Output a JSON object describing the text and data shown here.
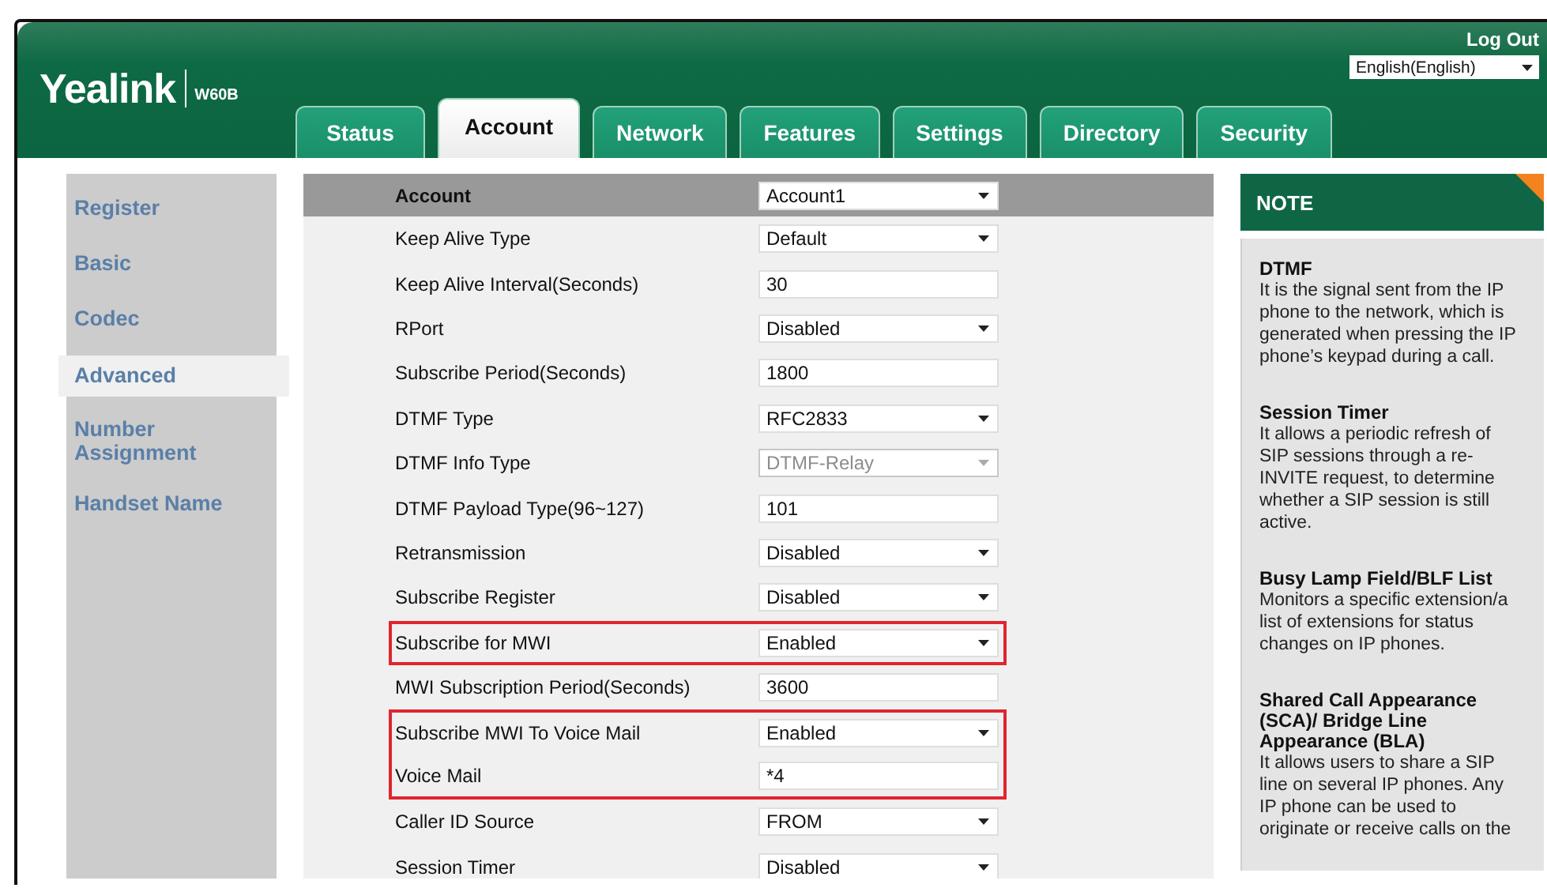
{
  "header": {
    "logo": "Yealink",
    "model": "W60B",
    "logout": "Log Out",
    "language": "English(English)"
  },
  "tabs": [
    {
      "label": "Status",
      "selected": false
    },
    {
      "label": "Account",
      "selected": true
    },
    {
      "label": "Network",
      "selected": false
    },
    {
      "label": "Features",
      "selected": false
    },
    {
      "label": "Settings",
      "selected": false
    },
    {
      "label": "Directory",
      "selected": false
    },
    {
      "label": "Security",
      "selected": false
    }
  ],
  "sidebar": {
    "items": [
      {
        "label": "Register",
        "selected": false
      },
      {
        "label": "Basic",
        "selected": false
      },
      {
        "label": "Codec",
        "selected": false
      },
      {
        "label": "Advanced",
        "selected": true
      },
      {
        "label": "Number Assignment",
        "selected": false
      },
      {
        "label": "Handset Name",
        "selected": false
      }
    ]
  },
  "form": {
    "title": "Account",
    "title_control": {
      "kind": "select",
      "value": "Account1",
      "disabled": false
    },
    "rows": [
      {
        "label": "Keep Alive Type",
        "kind": "select",
        "value": "Default",
        "disabled": false,
        "highlighted": false
      },
      {
        "label": "Keep Alive Interval(Seconds)",
        "kind": "text",
        "value": "30",
        "disabled": false,
        "highlighted": false
      },
      {
        "label": "RPort",
        "kind": "select",
        "value": "Disabled",
        "disabled": false,
        "highlighted": false
      },
      {
        "label": "Subscribe Period(Seconds)",
        "kind": "text",
        "value": "1800",
        "disabled": false,
        "highlighted": false
      },
      {
        "label": "DTMF Type",
        "kind": "select",
        "value": "RFC2833",
        "disabled": false,
        "highlighted": false
      },
      {
        "label": "DTMF Info Type",
        "kind": "select",
        "value": "DTMF-Relay",
        "disabled": true,
        "highlighted": false
      },
      {
        "label": "DTMF Payload Type(96~127)",
        "kind": "text",
        "value": "101",
        "disabled": false,
        "highlighted": false
      },
      {
        "label": "Retransmission",
        "kind": "select",
        "value": "Disabled",
        "disabled": false,
        "highlighted": false
      },
      {
        "label": "Subscribe Register",
        "kind": "select",
        "value": "Disabled",
        "disabled": false,
        "highlighted": false
      },
      {
        "label": "Subscribe for MWI",
        "kind": "select",
        "value": "Enabled",
        "disabled": false,
        "highlighted": true
      },
      {
        "label": "MWI Subscription Period(Seconds)",
        "kind": "text",
        "value": "3600",
        "disabled": false,
        "highlighted": false
      },
      {
        "label": "Subscribe MWI To Voice Mail",
        "kind": "select",
        "value": "Enabled",
        "disabled": false,
        "highlighted": true
      },
      {
        "label": "Voice Mail",
        "kind": "text",
        "value": "*4",
        "disabled": false,
        "highlighted": true
      },
      {
        "label": "Caller ID Source",
        "kind": "select",
        "value": "FROM",
        "disabled": false,
        "highlighted": false
      },
      {
        "label": "Session Timer",
        "kind": "select",
        "value": "Disabled",
        "disabled": false,
        "highlighted": false
      }
    ]
  },
  "note": {
    "title": "NOTE",
    "entries": [
      {
        "title": "DTMF",
        "text": "It is the signal sent from the IP phone to the network, which is generated when pressing the IP phone’s keypad during a call."
      },
      {
        "title": "Session Timer",
        "text": "It allows a periodic refresh of SIP sessions through a re-INVITE request, to determine whether a SIP session is still active."
      },
      {
        "title": "Busy Lamp Field/BLF List",
        "text": "Monitors a specific extension/a list of extensions for status changes on IP phones."
      },
      {
        "title": "Shared Call Appearance (SCA)/ Bridge Line Appearance (BLA)",
        "text": "It allows users to share a SIP line on several IP phones. Any IP phone can be used to originate or receive calls on the"
      }
    ]
  }
}
